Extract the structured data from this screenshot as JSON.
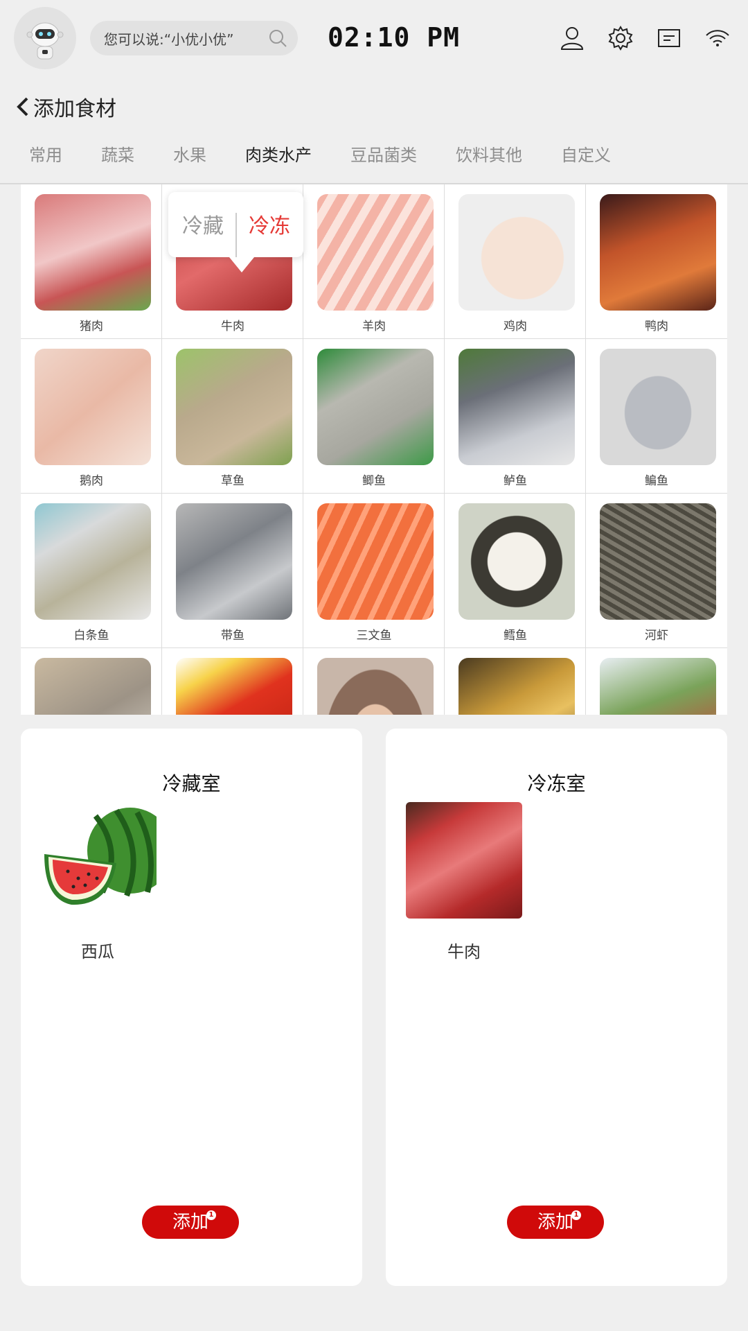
{
  "status_bar": {
    "search_placeholder": "您可以说:“小优小优”",
    "time": "02:10 PM"
  },
  "header": {
    "title": "添加食材"
  },
  "tabs": [
    {
      "label": "常用"
    },
    {
      "label": "蔬菜"
    },
    {
      "label": "水果"
    },
    {
      "label": "肉类水产",
      "active": true
    },
    {
      "label": "豆品菌类"
    },
    {
      "label": "饮料其他"
    },
    {
      "label": "自定义"
    }
  ],
  "grid": {
    "items": [
      {
        "label": "猪肉"
      },
      {
        "label": "牛肉"
      },
      {
        "label": "羊肉"
      },
      {
        "label": "鸡肉"
      },
      {
        "label": "鸭肉"
      },
      {
        "label": "鹅肉"
      },
      {
        "label": "草鱼"
      },
      {
        "label": "鲫鱼"
      },
      {
        "label": "鲈鱼"
      },
      {
        "label": "鳊鱼"
      },
      {
        "label": "白条鱼"
      },
      {
        "label": "带鱼"
      },
      {
        "label": "三文鱼"
      },
      {
        "label": "鳕鱼"
      },
      {
        "label": "河虾"
      }
    ]
  },
  "popover": {
    "option_refrigerate": "冷藏",
    "option_freeze": "冷冻",
    "selected": "冷冻"
  },
  "panels": {
    "fridge": {
      "title": "冷藏室",
      "items": [
        {
          "label": "西瓜"
        }
      ],
      "add_label": "添加",
      "badge": "1"
    },
    "freezer": {
      "title": "冷冻室",
      "items": [
        {
          "label": "牛肉"
        }
      ],
      "add_label": "添加",
      "badge": "1"
    }
  },
  "colors": {
    "accent_red": "#d00a0a",
    "popover_selected": "#e53935"
  }
}
